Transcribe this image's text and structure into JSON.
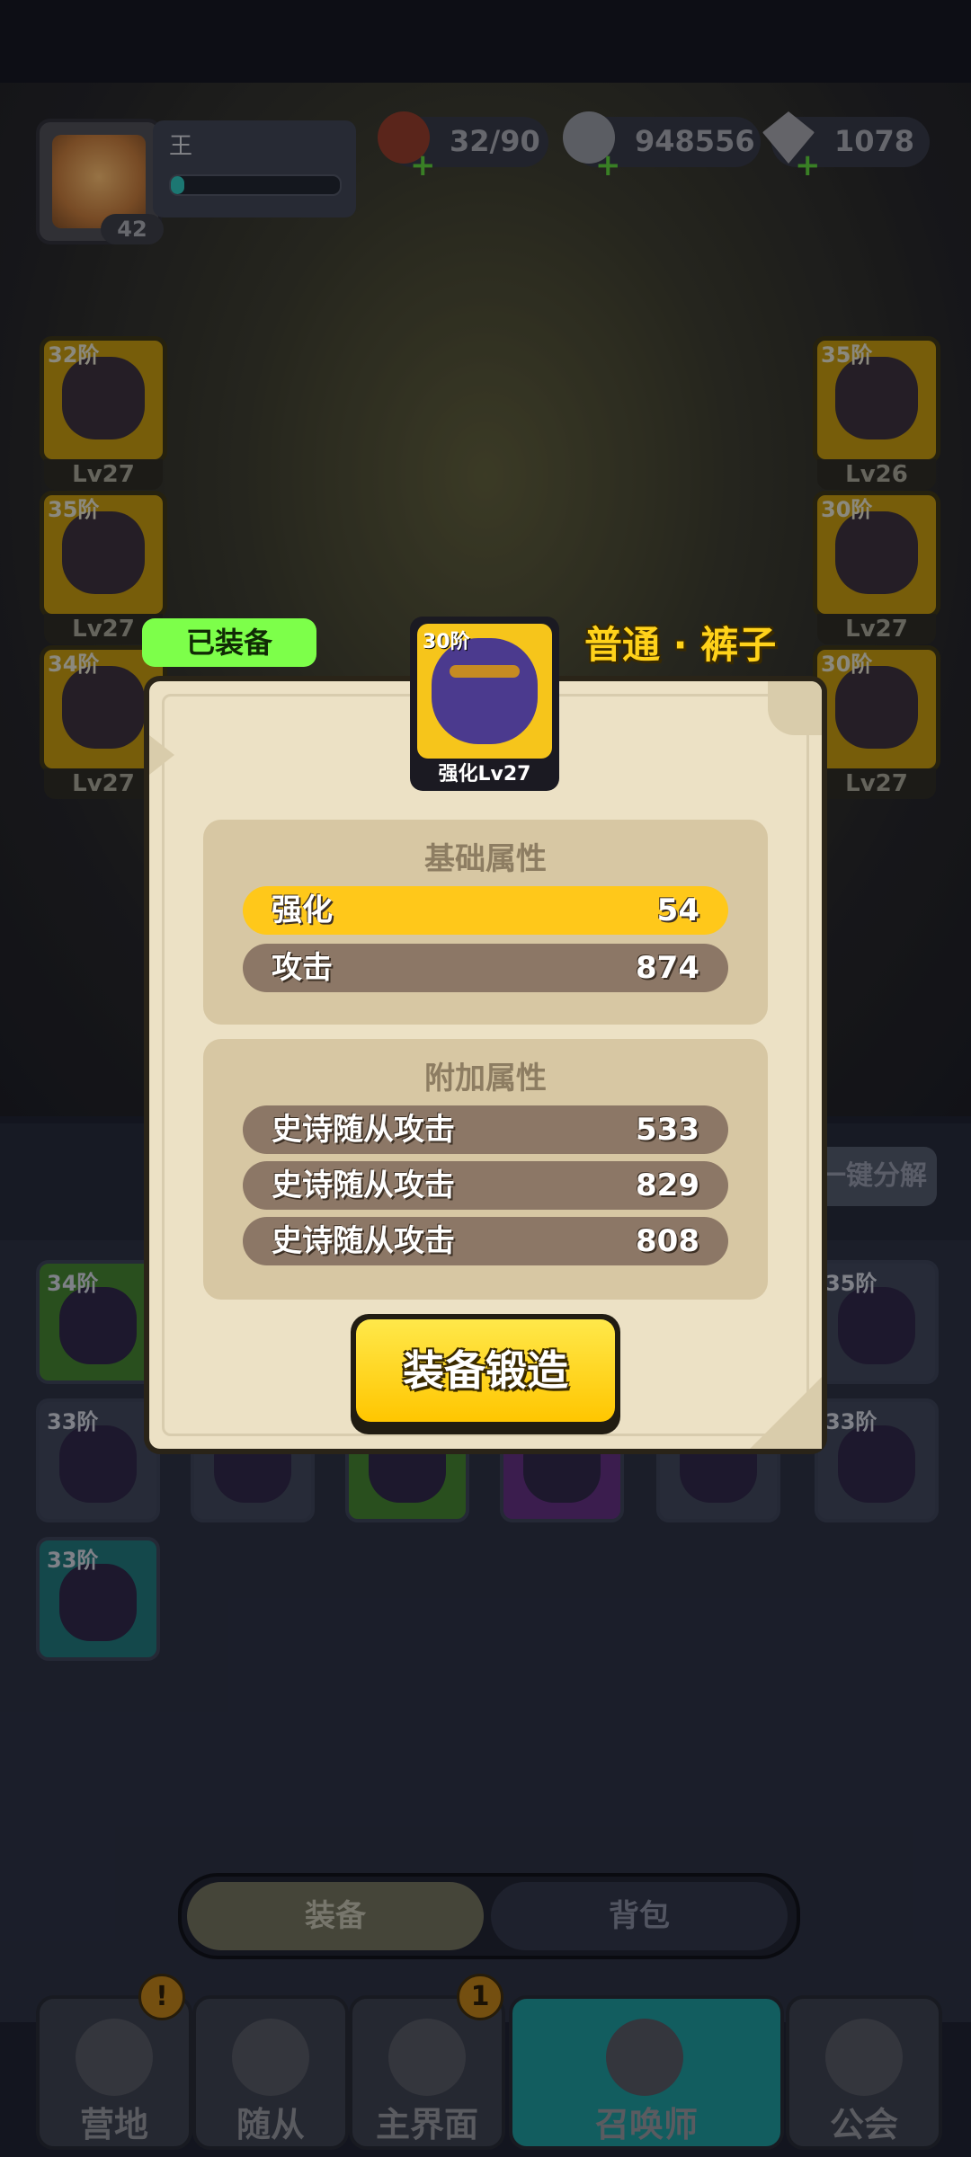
{
  "hud": {
    "player_name": "王",
    "player_level": "42",
    "xp_fraction": 0.08,
    "resources": [
      {
        "icon": "meat-stamina-icon",
        "value": "32/90"
      },
      {
        "icon": "stone-coin-icon",
        "value": "948556"
      },
      {
        "icon": "diamond-gem-icon",
        "value": "1078"
      }
    ]
  },
  "slots_left": [
    {
      "tier": "32阶",
      "level": "Lv27"
    },
    {
      "tier": "35阶",
      "level": "Lv27"
    },
    {
      "tier": "34阶",
      "level": "Lv27"
    }
  ],
  "slots_right": [
    {
      "tier": "35阶",
      "level": "Lv26"
    },
    {
      "tier": "30阶",
      "level": "Lv27"
    },
    {
      "tier": "30阶",
      "level": "Lv27"
    }
  ],
  "inventory": {
    "decompose_label": "一键分解",
    "items": [
      {
        "tier": "34阶"
      },
      {
        "tier": "35阶"
      },
      {
        "tier": "33阶"
      },
      {
        "tier": "33阶"
      },
      {
        "tier": "33阶"
      }
    ]
  },
  "tabs": {
    "equip": "装备",
    "bag": "背包"
  },
  "nav": [
    {
      "label": "营地",
      "badge": "!"
    },
    {
      "label": "随从",
      "badge": ""
    },
    {
      "label": "主界面",
      "badge": "1"
    },
    {
      "label": "召唤师",
      "badge": ""
    },
    {
      "label": "公会",
      "badge": ""
    }
  ],
  "modal": {
    "equipped_tag": "已装备",
    "item_name": "普通 · 裤子",
    "item_tier": "30阶",
    "item_level": "强化Lv27",
    "base_title": "基础属性",
    "base_stats": [
      {
        "label": "强化",
        "value": "54"
      },
      {
        "label": "攻击",
        "value": "874"
      }
    ],
    "extra_title": "附加属性",
    "extra_stats": [
      {
        "label": "史诗随从攻击",
        "value": "533"
      },
      {
        "label": "史诗随从攻击",
        "value": "829"
      },
      {
        "label": "史诗随从攻击",
        "value": "808"
      }
    ],
    "forge_button": "装备锻造"
  },
  "colors": {
    "highlight_row": "#ffc81a",
    "stat_row": "#8c7766",
    "equipped_tag": "#7dff4a",
    "item_name": "#ffd21a"
  }
}
